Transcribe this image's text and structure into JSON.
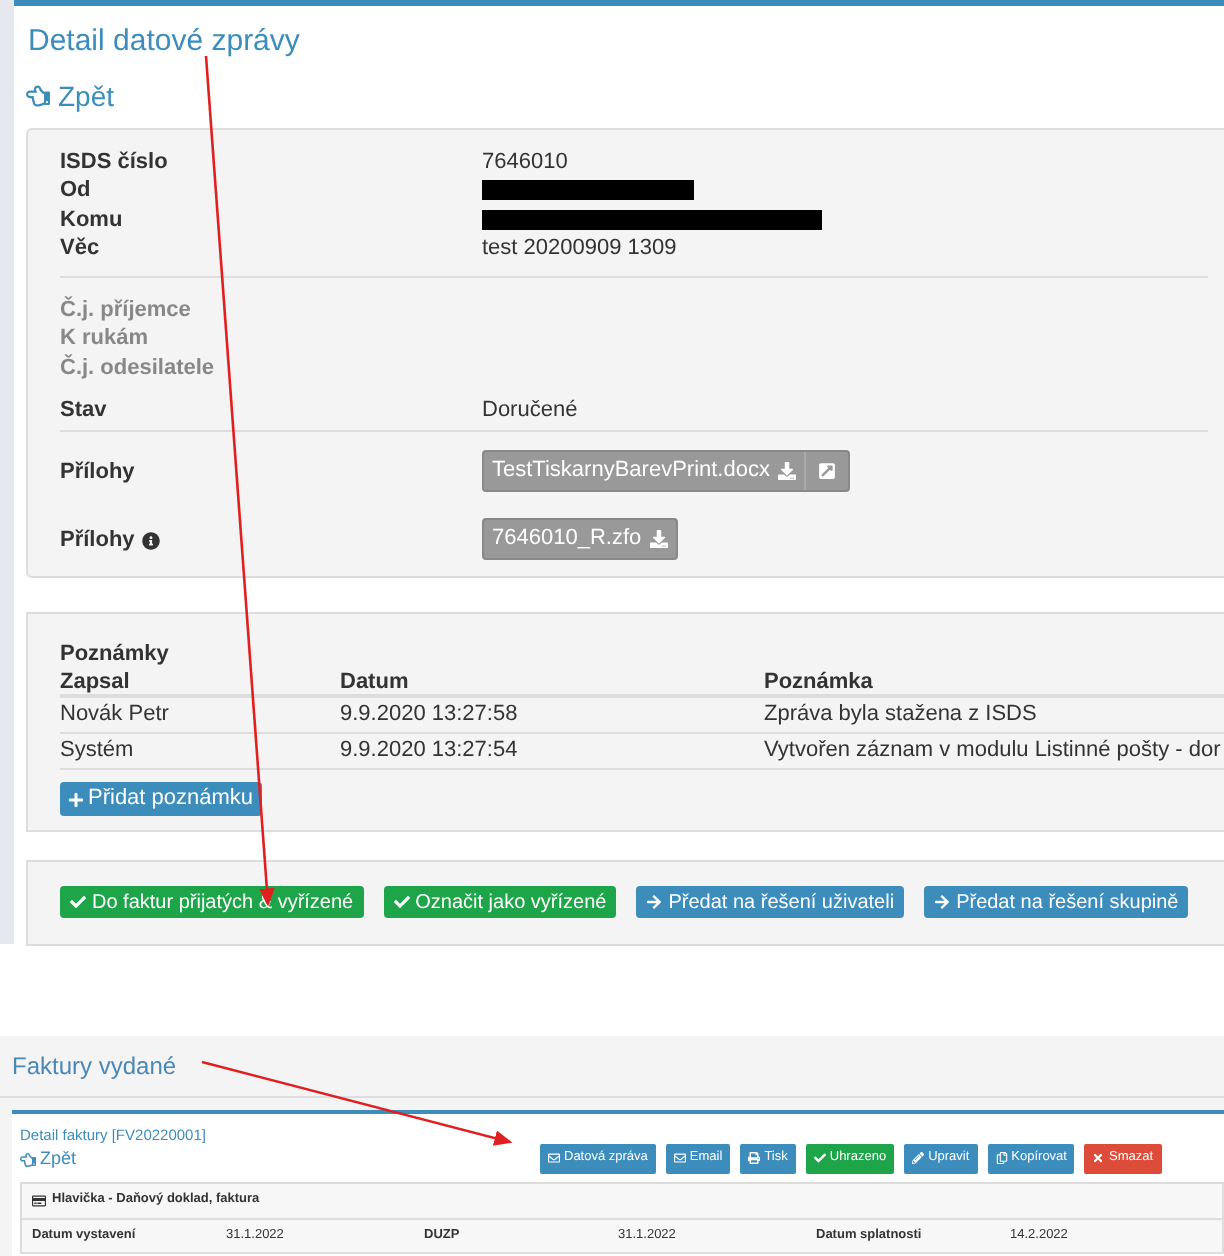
{
  "detail": {
    "title": "Detail datové zprávy",
    "back": "Zpět",
    "fields": [
      {
        "label": "ISDS číslo",
        "value": "7646010",
        "redacted": false
      },
      {
        "label": "Od",
        "redacted": true
      },
      {
        "label": "Komu",
        "redacted": true
      },
      {
        "label": "Věc",
        "value": "test 20200909 1309",
        "redacted": false
      }
    ],
    "ref_fields": [
      "Č.j. příjemce",
      "K rukám",
      "Č.j. odesilatele"
    ],
    "status": {
      "label": "Stav",
      "value": "Doručené"
    },
    "attachments": [
      {
        "label": "Přílohy",
        "file": "TestTiskarnyBarevPrint.docx",
        "has_info": false,
        "has_open": true
      },
      {
        "label": "Přílohy",
        "file": "7646010_R.zfo",
        "has_info": true,
        "has_open": false
      }
    ]
  },
  "notes": {
    "title": "Poznámky",
    "columns": [
      "Zapsal",
      "Datum",
      "Poznámka"
    ],
    "rows": [
      [
        "Novák Petr",
        "9.9.2020 13:27:58",
        "Zpráva byla stažena z ISDS"
      ],
      [
        "Systém",
        "9.9.2020 13:27:54",
        "Vytvořen záznam v modulu Listinné pošty - dor"
      ]
    ],
    "add_button": "Přidat poznámku"
  },
  "actions": [
    {
      "label": "Do faktur přijatých & vyřízené",
      "kind": "success"
    },
    {
      "label": "Označit jako vyřízené",
      "kind": "success"
    },
    {
      "label": "Předat na řešení uživateli",
      "kind": "primary"
    },
    {
      "label": "Předat na řešení skupině",
      "kind": "primary"
    }
  ],
  "invoice": {
    "page_title": "Faktury vydané",
    "title": "Detail faktury [FV20220001]",
    "back": "Zpět",
    "buttons": [
      {
        "label": "Datová zpráva",
        "kind": "primary"
      },
      {
        "label": "Email",
        "kind": "primary"
      },
      {
        "label": "Tisk",
        "kind": "primary"
      },
      {
        "label": "Uhrazeno",
        "kind": "success"
      },
      {
        "label": "Upravit",
        "kind": "primary"
      },
      {
        "label": "Kopírovat",
        "kind": "primary"
      },
      {
        "label": "Smazat",
        "kind": "danger"
      }
    ],
    "section": "Hlavička - Daňový doklad, faktura",
    "cells": [
      {
        "label": "Datum vystavení",
        "value": "31.1.2022"
      },
      {
        "label": "DUZP",
        "value": "31.1.2022"
      },
      {
        "label": "Datum splatnosti",
        "value": "14.2.2022"
      }
    ]
  }
}
